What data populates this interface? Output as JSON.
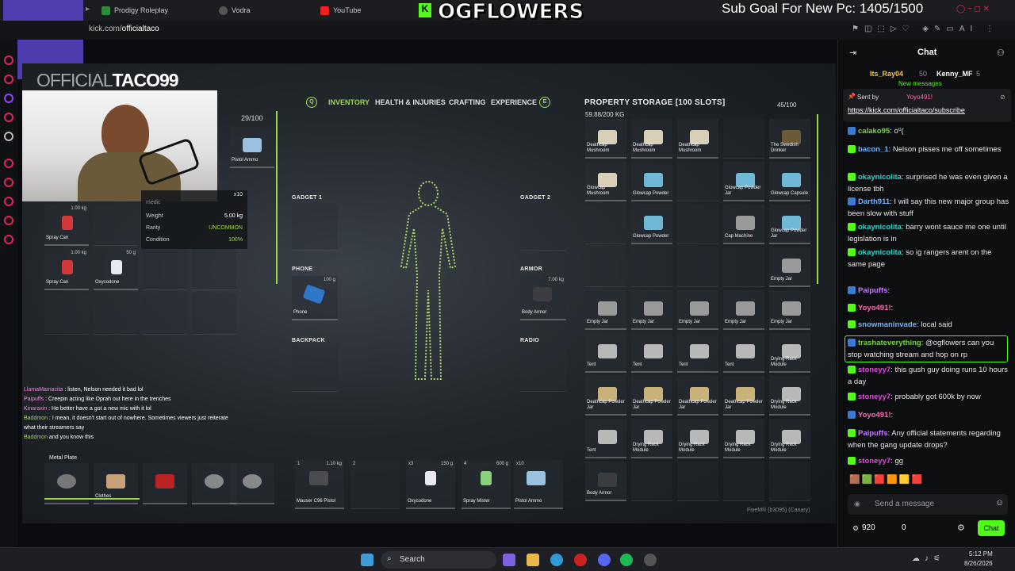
{
  "browser": {
    "tabs": [
      "Prodigy Roleplay",
      "Vodra",
      "YouTube"
    ],
    "url_prefix": "kick.com/",
    "url_path": "officialtaco"
  },
  "overlay": {
    "brand": "OGFLOWERS",
    "sub_goal": "Sub Goal For New Pc: 1405/1500",
    "streamer_logo_a": "OFFICIAL",
    "streamer_logo_b": "TACO99"
  },
  "game": {
    "tabs": [
      "INVENTORY",
      "HEALTH & INJURIES",
      "CRAFTING",
      "EXPERIENCE"
    ],
    "tab_keys": [
      "Q",
      "E"
    ],
    "player_weight": "29/100",
    "item_tooltip": {
      "weight_label": "Weight",
      "weight": "5.00 kg",
      "rarity_label": "Rarity",
      "rarity": "UNCOMMON",
      "condition_label": "Condition",
      "condition": "100%",
      "qty": "x10",
      "desc": "medic"
    },
    "player_items": [
      {
        "label": "Pistol Ammo"
      },
      {
        "label": "Spray Can",
        "w": "1.00 kg"
      },
      {
        "label": "Spray Can",
        "w": "1.00 kg"
      },
      {
        "label": "Oxycodone",
        "w": "50 g"
      }
    ],
    "bottom_row": {
      "label": "Metal Plate",
      "clothes": "Clothes"
    },
    "equipment": {
      "gadget1": "GADGET 1",
      "gadget2": "GADGET 2",
      "phone": "PHONE",
      "phone_item": "Phone",
      "phone_w": "100 g",
      "armor": "ARMOR",
      "armor_item": "Body Armor",
      "armor_w": "7.00 kg",
      "backpack": "BACKPACK",
      "radio": "RADIO"
    },
    "hotbar": [
      {
        "n": "1",
        "w": "1.10 kg",
        "label": "Mauser C96 Pistol"
      },
      {
        "n": "2",
        "w": "",
        "label": ""
      },
      {
        "n": "3",
        "w": "150 g",
        "label": "Oxycodone",
        "qty": "x3"
      },
      {
        "n": "4",
        "w": "600 g",
        "label": "Spray Mister"
      },
      {
        "n": "5",
        "w": "",
        "label": "Pistol Ammo",
        "qty": "x10"
      }
    ],
    "storage": {
      "title": "PROPERTY STORAGE [100 SLOTS]",
      "weight": "59.88/200 KG",
      "slots": "45/100",
      "items": [
        "Deathcap Mushroom",
        "Deathcap Mushroom",
        "Deathcap Mushroom",
        "",
        "The Swedish Drinker",
        "Glowcap Mushroom",
        "Glowcap Powder",
        "",
        "Glowcap Powder Jar",
        "Glowcap Capsule",
        "",
        "Glowcap Powder",
        "",
        "Cap Machine",
        "Glowcap Powder Jar",
        "",
        "",
        "",
        "",
        "Empty Jar",
        "Empty Jar",
        "Empty Jar",
        "Empty Jar",
        "Empty Jar",
        "Empty Jar",
        "Tent",
        "Tent",
        "Tent",
        "Tent",
        "Drying Rack Module",
        "Deathcap Powder Jar",
        "Deathcap Powder Jar",
        "Deathcap Powder Jar",
        "Deathcap Powder Jar",
        "Drying Rack Module",
        "Tent",
        "Drying Rack Module",
        "Drying Rack Module",
        "Drying Rack Module",
        "Drying Rack Module",
        "Body Armor",
        "",
        "",
        "",
        ""
      ]
    },
    "overlay_chat": [
      {
        "user": "LlamaMamacita",
        "text": "listen, Nelson needed it bad lol"
      },
      {
        "user": "Paipuffs",
        "text": "Creepin acting like Oprah out here in the trenches"
      },
      {
        "user": "Kinaraxin",
        "text": "He better have a got a new mic with it lol"
      },
      {
        "user": "Baddmon",
        "text": "I mean, it doesn't start out of nowhere. Sometimes viewers just reiterate what their streamers say"
      },
      {
        "user": "Baddmon",
        "text": "and you know this"
      }
    ],
    "fivem": "FiveM® (b3095) (Canary)"
  },
  "chat": {
    "title": "Chat",
    "top_gifters": [
      {
        "user": "Its_Ray04",
        "n": "50"
      },
      {
        "user": "Kenny_MF",
        "n": "5"
      }
    ],
    "new_messages": "New messages",
    "pinned": {
      "sent_by": "Sent by",
      "user": "Yoyo491!",
      "link": "https://kick.com/officialtaco/subscribe"
    },
    "messages": [
      {
        "user": "calako95",
        "text": "o⁰(",
        "c": "u2"
      },
      {
        "user": "bacon_1",
        "text": "Nelson pisses me off sometimes",
        "c": "u1"
      },
      {
        "user": "okaynicolita",
        "text": "surprised he was even given a license tbh",
        "c": "u6"
      },
      {
        "user": "Darth911",
        "text": "I will say this new major group has been slow with stuff",
        "c": "u1"
      },
      {
        "user": "okaynicolita",
        "text": "barry wont sauce me one until legislation is in",
        "c": "u6"
      },
      {
        "user": "okaynicolita",
        "text": "so ig rangers arent on the same page",
        "c": "u6"
      },
      {
        "user": "Paipuffs",
        "text": "",
        "c": "u3"
      },
      {
        "user": "Yoyo491!",
        "text": "",
        "c": "u4"
      },
      {
        "user": "snowmaninvade",
        "text": "local said",
        "c": "u1"
      },
      {
        "user": "trashateverything",
        "text": "@ogflowers can you stop watching stream and hop on rp",
        "c": "u2"
      },
      {
        "user": "stoneyy7",
        "text": "this gush guy doing runs 10 hours a day",
        "c": "u5"
      },
      {
        "user": "stoneyy7",
        "text": "probably got 600k by now",
        "c": "u5"
      },
      {
        "user": "Yoyo491!",
        "text": "",
        "c": "u4"
      },
      {
        "user": "Paipuffs",
        "text": "Any official statements regarding when the gang update drops?",
        "c": "u3"
      },
      {
        "user": "stoneyy7",
        "text": "gg",
        "c": "u5"
      }
    ],
    "input_placeholder": "Send a message",
    "viewers": "920",
    "points": "0",
    "send_label": "Chat"
  },
  "taskbar": {
    "search": "Search",
    "time": "5:12 PM",
    "date": "8/26/2026"
  },
  "colors": {
    "kick_green": "#53fc18",
    "accent": "#9bd64a"
  }
}
